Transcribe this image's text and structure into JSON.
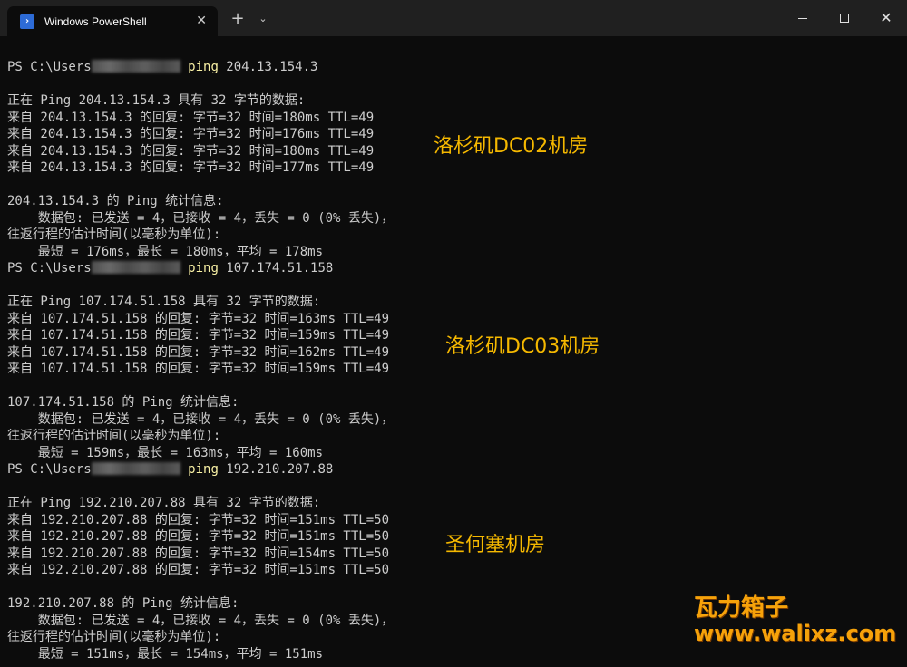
{
  "window": {
    "tab_title": "Windows PowerShell",
    "tab_icon": "powershell-icon",
    "tab_close": "✕",
    "new_tab": "+",
    "dropdown": "⌄",
    "close": "✕"
  },
  "colors": {
    "background": "#0c0c0c",
    "titlebar": "#202020",
    "text": "#cccccc",
    "command": "#f9f1a5",
    "annotation": "#f5b800",
    "watermark": "#f6a20a"
  },
  "blocks": [
    {
      "prompt": "PS C:\\Users",
      "command": "ping",
      "target": " 204.13.154.3",
      "header": "正在 Ping 204.13.154.3 具有 32 字节的数据:",
      "replies": [
        "来自 204.13.154.3 的回复: 字节=32 时间=180ms TTL=49",
        "来自 204.13.154.3 的回复: 字节=32 时间=176ms TTL=49",
        "来自 204.13.154.3 的回复: 字节=32 时间=180ms TTL=49",
        "来自 204.13.154.3 的回复: 字节=32 时间=177ms TTL=49"
      ],
      "stats_title": "204.13.154.3 的 Ping 统计信息:",
      "packets": "    数据包: 已发送 = 4，已接收 = 4，丢失 = 0 (0% 丢失)，",
      "rtt_title": "往返行程的估计时间(以毫秒为单位):",
      "rtt": "    最短 = 176ms，最长 = 180ms，平均 = 178ms",
      "annotation": "洛杉矶DC02机房"
    },
    {
      "prompt": "PS C:\\Users",
      "command": "ping",
      "target": " 107.174.51.158",
      "header": "正在 Ping 107.174.51.158 具有 32 字节的数据:",
      "replies": [
        "来自 107.174.51.158 的回复: 字节=32 时间=163ms TTL=49",
        "来自 107.174.51.158 的回复: 字节=32 时间=159ms TTL=49",
        "来自 107.174.51.158 的回复: 字节=32 时间=162ms TTL=49",
        "来自 107.174.51.158 的回复: 字节=32 时间=159ms TTL=49"
      ],
      "stats_title": "107.174.51.158 的 Ping 统计信息:",
      "packets": "    数据包: 已发送 = 4，已接收 = 4，丢失 = 0 (0% 丢失)，",
      "rtt_title": "往返行程的估计时间(以毫秒为单位):",
      "rtt": "    最短 = 159ms，最长 = 163ms，平均 = 160ms",
      "annotation": "洛杉矶DC03机房"
    },
    {
      "prompt": "PS C:\\Users",
      "command": "ping",
      "target": " 192.210.207.88",
      "header": "正在 Ping 192.210.207.88 具有 32 字节的数据:",
      "replies": [
        "来自 192.210.207.88 的回复: 字节=32 时间=151ms TTL=50",
        "来自 192.210.207.88 的回复: 字节=32 时间=151ms TTL=50",
        "来自 192.210.207.88 的回复: 字节=32 时间=154ms TTL=50",
        "来自 192.210.207.88 的回复: 字节=32 时间=151ms TTL=50"
      ],
      "stats_title": "192.210.207.88 的 Ping 统计信息:",
      "packets": "    数据包: 已发送 = 4，已接收 = 4，丢失 = 0 (0% 丢失)，",
      "rtt_title": "往返行程的估计时间(以毫秒为单位):",
      "rtt": "    最短 = 151ms，最长 = 154ms，平均 = 151ms",
      "annotation": "圣何塞机房"
    }
  ],
  "watermark": {
    "name": "瓦力箱子",
    "url": "www.walixz.com"
  }
}
